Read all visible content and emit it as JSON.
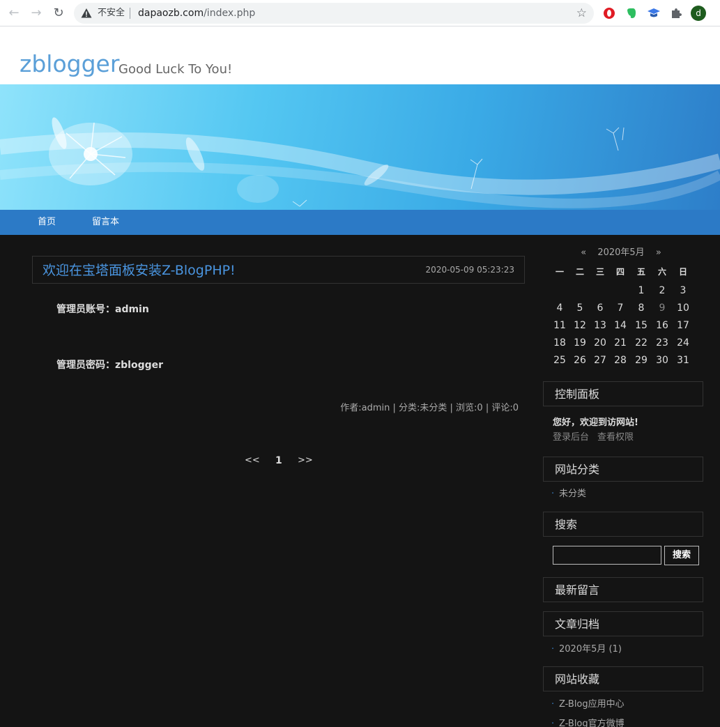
{
  "browser": {
    "insecure_label": "不安全",
    "url_domain": "dapaozb.com",
    "url_path": "/index.php",
    "avatar_letter": "d"
  },
  "header": {
    "title": "zblogger",
    "subtitle": "Good Luck To You!"
  },
  "nav": {
    "items": [
      "首页",
      "留言本"
    ]
  },
  "post": {
    "title": "欢迎在宝塔面板安装Z-BlogPHP!",
    "date": "2020-05-09 05:23:23",
    "line1": "管理员账号：admin",
    "line2": "管理员密码：zblogger",
    "meta": "作者:admin | 分类:未分类 | 浏览:0 | 评论:0"
  },
  "pager": {
    "prev": "<<",
    "current": "1",
    "next": ">>"
  },
  "calendar": {
    "prev": "«",
    "month": "2020年5月",
    "next": "»",
    "weekdays": [
      "一",
      "二",
      "三",
      "四",
      "五",
      "六",
      "日"
    ],
    "weeks": [
      [
        "",
        "",
        "",
        "",
        "1",
        "2",
        "3"
      ],
      [
        "4",
        "5",
        "6",
        "7",
        "8",
        "9",
        "10"
      ],
      [
        "11",
        "12",
        "13",
        "14",
        "15",
        "16",
        "17"
      ],
      [
        "18",
        "19",
        "20",
        "21",
        "22",
        "23",
        "24"
      ],
      [
        "25",
        "26",
        "27",
        "28",
        "29",
        "30",
        "31"
      ]
    ],
    "highlight_day": "9"
  },
  "sidebar": {
    "control_title": "控制面板",
    "welcome": "您好，欢迎到访网站!",
    "login": "登录后台",
    "permissions": "查看权限",
    "category_title": "网站分类",
    "category_item": "未分类",
    "search_title": "搜索",
    "search_button": "搜索",
    "latest_title": "最新留言",
    "archive_title": "文章归档",
    "archive_item": "2020年5月 (1)",
    "favorites_title": "网站收藏",
    "favorites": [
      "Z-Blog应用中心",
      "Z-Blog官方微博"
    ]
  },
  "colors": {
    "accent": "#4a95e0",
    "navbar": "#2c7ac6",
    "background": "#141414"
  }
}
